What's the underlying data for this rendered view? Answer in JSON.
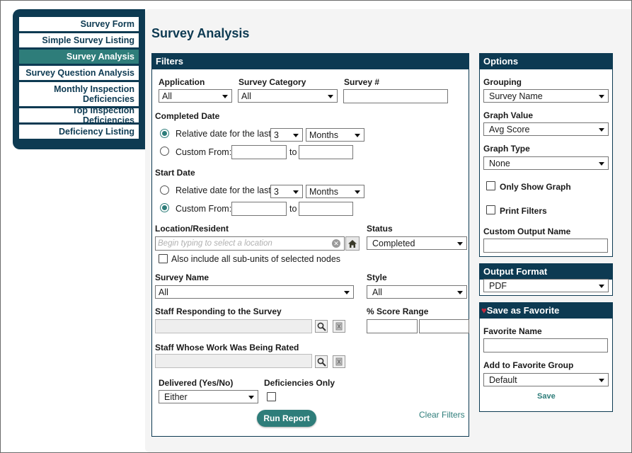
{
  "sidebar": {
    "items": [
      {
        "label": "Survey Form"
      },
      {
        "label": "Simple Survey Listing"
      },
      {
        "label": "Survey Analysis"
      },
      {
        "label": "Survey Question Analysis"
      },
      {
        "label": "Monthly Inspection Deficiencies"
      },
      {
        "label": "Top Inspection Deficiencies"
      },
      {
        "label": "Deficiency Listing"
      }
    ],
    "active_index": 2
  },
  "page_title": "Survey Analysis",
  "filters": {
    "title": "Filters",
    "application": {
      "label": "Application",
      "value": "All"
    },
    "survey_category": {
      "label": "Survey Category",
      "value": "All"
    },
    "survey_number": {
      "label": "Survey #",
      "value": ""
    },
    "completed_date": {
      "label": "Completed Date",
      "relative_label": "Relative date for the last",
      "relative_count": "3",
      "relative_unit": "Months",
      "custom_label": "Custom From:",
      "to_label": "to",
      "selected": "relative"
    },
    "start_date": {
      "label": "Start Date",
      "relative_label": "Relative date for the last",
      "relative_count": "3",
      "relative_unit": "Months",
      "custom_label": "Custom From:",
      "to_label": "to",
      "selected": "custom"
    },
    "location": {
      "label": "Location/Resident",
      "placeholder": "Begin typing to select a location",
      "subunits_label": "Also include all sub-units of selected nodes"
    },
    "status": {
      "label": "Status",
      "value": "Completed"
    },
    "survey_name": {
      "label": "Survey Name",
      "value": "All"
    },
    "style": {
      "label": "Style",
      "value": "All"
    },
    "staff_responding": {
      "label": "Staff Responding to the Survey"
    },
    "score_range": {
      "label": "% Score Range"
    },
    "staff_rated": {
      "label": "Staff Whose Work Was Being Rated"
    },
    "delivered": {
      "label": "Delivered (Yes/No)",
      "value": "Either"
    },
    "deficiencies_only": {
      "label": "Deficiencies Only"
    },
    "run_report_label": "Run Report",
    "clear_filters_label": "Clear Filters"
  },
  "options": {
    "title": "Options",
    "grouping": {
      "label": "Grouping",
      "value": "Survey Name"
    },
    "graph_value": {
      "label": "Graph Value",
      "value": "Avg Score"
    },
    "graph_type": {
      "label": "Graph Type",
      "value": "None"
    },
    "only_show_graph_label": "Only Show Graph",
    "print_filters_label": "Print Filters",
    "custom_output_name_label": "Custom Output Name"
  },
  "output_format": {
    "title": "Output Format",
    "value": "PDF"
  },
  "favorite": {
    "title": "Save as Favorite",
    "name_label": "Favorite Name",
    "group_label": "Add to Favorite Group",
    "group_value": "Default",
    "save_label": "Save"
  },
  "colors": {
    "navy": "#0d3a52",
    "teal": "#2e7d7a",
    "heart": "#c0283c"
  }
}
